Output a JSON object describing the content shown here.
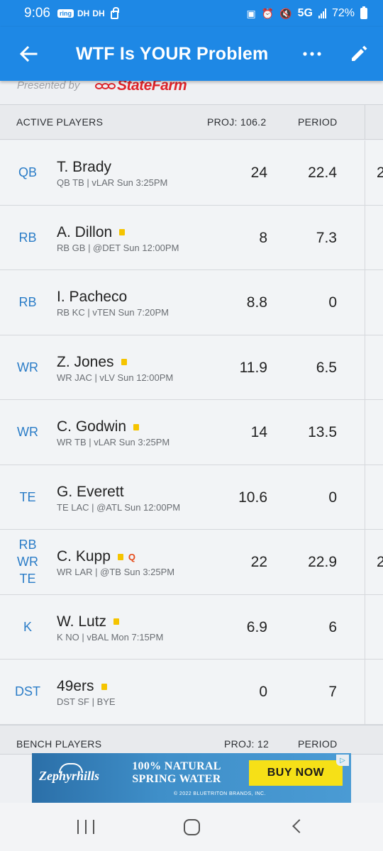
{
  "status_bar": {
    "time": "9:06",
    "ring_label": "ring",
    "indicator_1": "DH",
    "indicator_2": "DH",
    "network": "5G",
    "battery": "72%"
  },
  "app_bar": {
    "title": "WTF Is YOUR Problem",
    "back_icon": "arrow-left-icon",
    "more_icon": "more-horizontal-icon",
    "edit_icon": "pencil-icon"
  },
  "sponsor": {
    "presented_by": "Presented by",
    "brand": "StateFarm"
  },
  "active_header": {
    "label": "ACTIVE PLAYERS",
    "proj": "PROJ: 106.2",
    "period": "PERIOD"
  },
  "players": [
    {
      "pos": [
        "QB"
      ],
      "name": "T. Brady",
      "info": "QB TB | vLAR Sun 3:25PM",
      "note": false,
      "q": "",
      "proj": "24",
      "period": "22.4",
      "extra": "2"
    },
    {
      "pos": [
        "RB"
      ],
      "name": "A. Dillon",
      "info": "RB GB | @DET Sun 12:00PM",
      "note": true,
      "q": "",
      "proj": "8",
      "period": "7.3",
      "extra": ""
    },
    {
      "pos": [
        "RB"
      ],
      "name": "I. Pacheco",
      "info": "RB KC | vTEN Sun 7:20PM",
      "note": false,
      "q": "",
      "proj": "8.8",
      "period": "0",
      "extra": ""
    },
    {
      "pos": [
        "WR"
      ],
      "name": "Z. Jones",
      "info": "WR JAC | vLV Sun 12:00PM",
      "note": true,
      "q": "",
      "proj": "11.9",
      "period": "6.5",
      "extra": ""
    },
    {
      "pos": [
        "WR"
      ],
      "name": "C. Godwin",
      "info": "WR TB | vLAR Sun 3:25PM",
      "note": true,
      "q": "",
      "proj": "14",
      "period": "13.5",
      "extra": ""
    },
    {
      "pos": [
        "TE"
      ],
      "name": "G. Everett",
      "info": "TE LAC | @ATL Sun 12:00PM",
      "note": false,
      "q": "",
      "proj": "10.6",
      "period": "0",
      "extra": ""
    },
    {
      "pos": [
        "RB",
        "WR",
        "TE"
      ],
      "name": "C. Kupp",
      "info": "WR LAR | @TB Sun 3:25PM",
      "note": true,
      "q": "Q",
      "proj": "22",
      "period": "22.9",
      "extra": "2"
    },
    {
      "pos": [
        "K"
      ],
      "name": "W. Lutz",
      "info": "K NO | vBAL Mon 7:15PM",
      "note": true,
      "q": "",
      "proj": "6.9",
      "period": "6",
      "extra": ""
    },
    {
      "pos": [
        "DST"
      ],
      "name": "49ers",
      "info": "DST SF | BYE",
      "note": true,
      "q": "",
      "proj": "0",
      "period": "7",
      "extra": ""
    }
  ],
  "bench_header": {
    "label": "BENCH PLAYERS",
    "proj": "PROJ: 12",
    "period": "PERIOD"
  },
  "ad": {
    "brand": "Zephyrhills",
    "headline_1": "100% NATURAL",
    "headline_2": "SPRING WATER",
    "cta": "BUY NOW",
    "copyright": "© 2022 BLUETRITON BRANDS, INC."
  },
  "nav_bar": {
    "recents_icon": "recents-icon",
    "home_icon": "home-icon",
    "back_icon": "back-chevron-icon"
  }
}
